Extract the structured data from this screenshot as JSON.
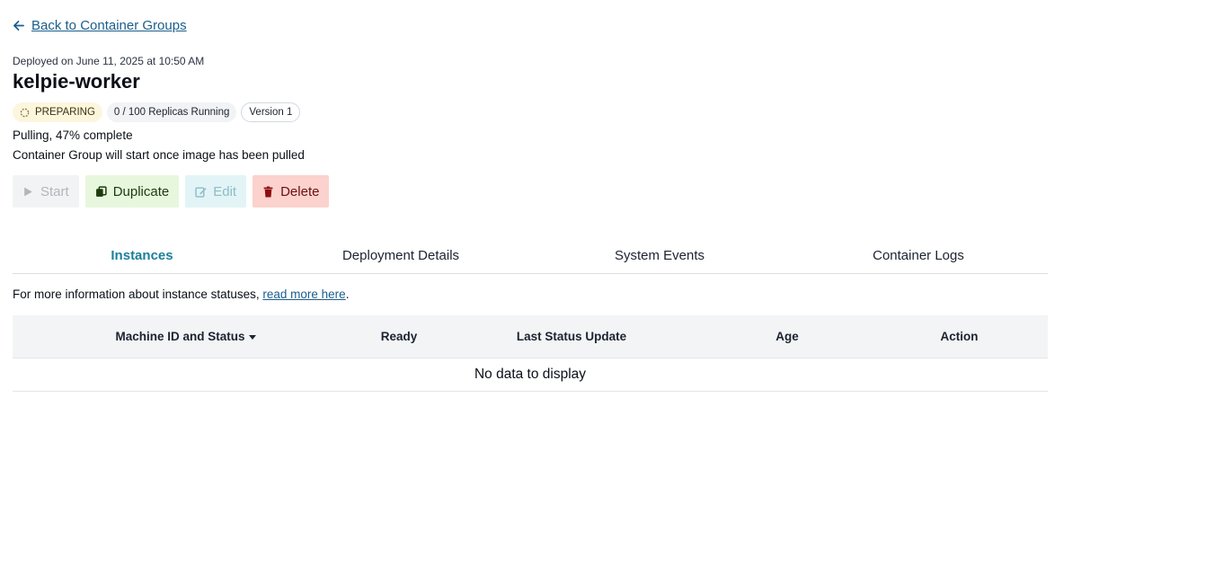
{
  "back_link": {
    "label": "Back to Container Groups",
    "icon": "arrow-left-icon"
  },
  "deployed_text": "Deployed on June 11, 2025 at 10:50 AM",
  "title": "kelpie-worker",
  "badges": {
    "status": {
      "label": "PREPARING",
      "icon": "spinner-icon",
      "color": "#fcf6dd"
    },
    "replicas": {
      "label": "0 / 100 Replicas Running"
    },
    "version": {
      "label": "Version 1"
    }
  },
  "status_lines": {
    "progress": "Pulling, 47% complete",
    "note": "Container Group will start once image has been pulled"
  },
  "actions": {
    "start": {
      "label": "Start",
      "icon": "play-icon",
      "enabled": false
    },
    "duplicate": {
      "label": "Duplicate",
      "icon": "copy-icon",
      "enabled": true
    },
    "edit": {
      "label": "Edit",
      "icon": "edit-icon",
      "enabled": false
    },
    "delete": {
      "label": "Delete",
      "icon": "trash-icon",
      "enabled": true
    }
  },
  "tabs": [
    {
      "label": "Instances",
      "active": true
    },
    {
      "label": "Deployment Details",
      "active": false
    },
    {
      "label": "System Events",
      "active": false
    },
    {
      "label": "Container Logs",
      "active": false
    }
  ],
  "info": {
    "prefix": "For more information about instance statuses, ",
    "link": "read more here",
    "suffix": "."
  },
  "table": {
    "columns": [
      "Machine ID and Status",
      "Ready",
      "Last Status Update",
      "Age",
      "Action"
    ],
    "sorted_column": "Machine ID and Status",
    "empty_text": "No data to display"
  },
  "colors": {
    "link": "#1a5e8c",
    "active_tab": "#1b7f9a",
    "duplicate_bg": "#e7f7dd",
    "delete_bg": "#fbd2cd"
  }
}
